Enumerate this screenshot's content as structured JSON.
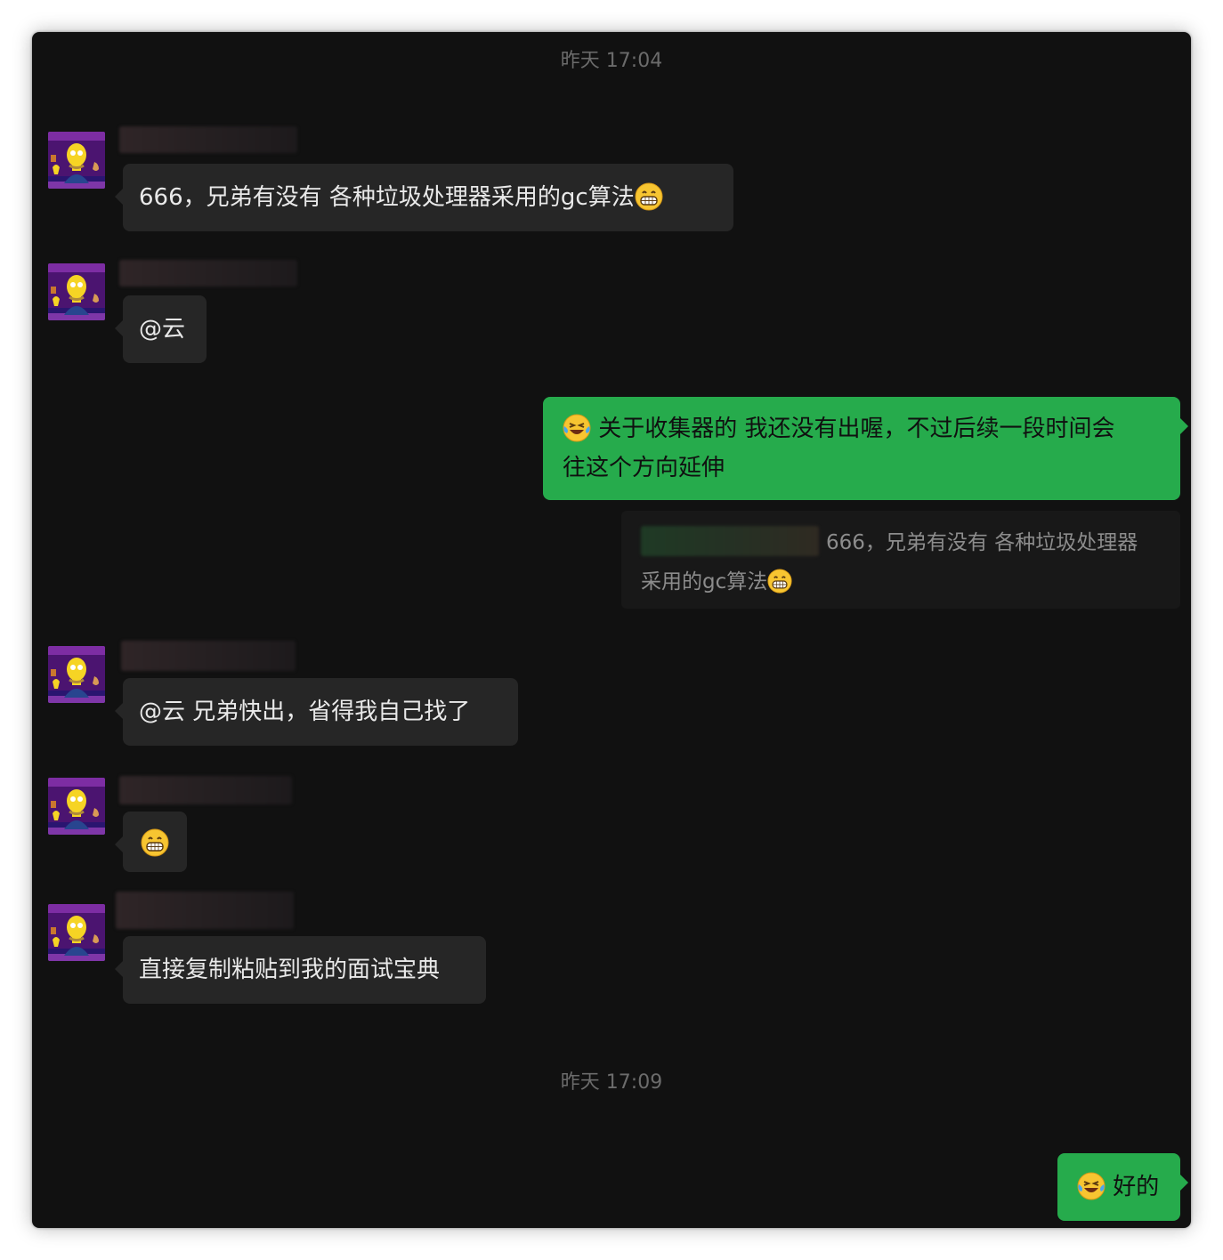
{
  "timestamps": [
    "昨天 17:04",
    "昨天 17:09"
  ],
  "messages": [
    {
      "side": "in",
      "text": "666，兄弟有没有 各种垃圾处理器采用的gc算法",
      "emoji": "grin-emoji"
    },
    {
      "side": "in",
      "text": "@云"
    },
    {
      "side": "out",
      "emoji": "laugh-cry-emoji",
      "line1": " 关于收集器的 我还没有出喔，不过后续一段时间会",
      "line2": "往这个方向延伸"
    },
    {
      "side": "in",
      "text": "@云 兄弟快出，省得我自己找了"
    },
    {
      "side": "in",
      "text": "",
      "emoji": "grin-emoji"
    },
    {
      "side": "in",
      "text": "直接复制粘贴到我的面试宝典"
    },
    {
      "side": "out",
      "emoji": "laugh-cry-emoji",
      "text": " 好的"
    }
  ],
  "quote": {
    "line1": "666，兄弟有没有 各种垃圾处理器",
    "line2": "采用的gc算法",
    "emoji": "grin-emoji"
  },
  "colors": {
    "background": "#111111",
    "incoming_bubble": "#262626",
    "outgoing_bubble": "#26ab4c",
    "timestamp": "#6b6b6b"
  }
}
